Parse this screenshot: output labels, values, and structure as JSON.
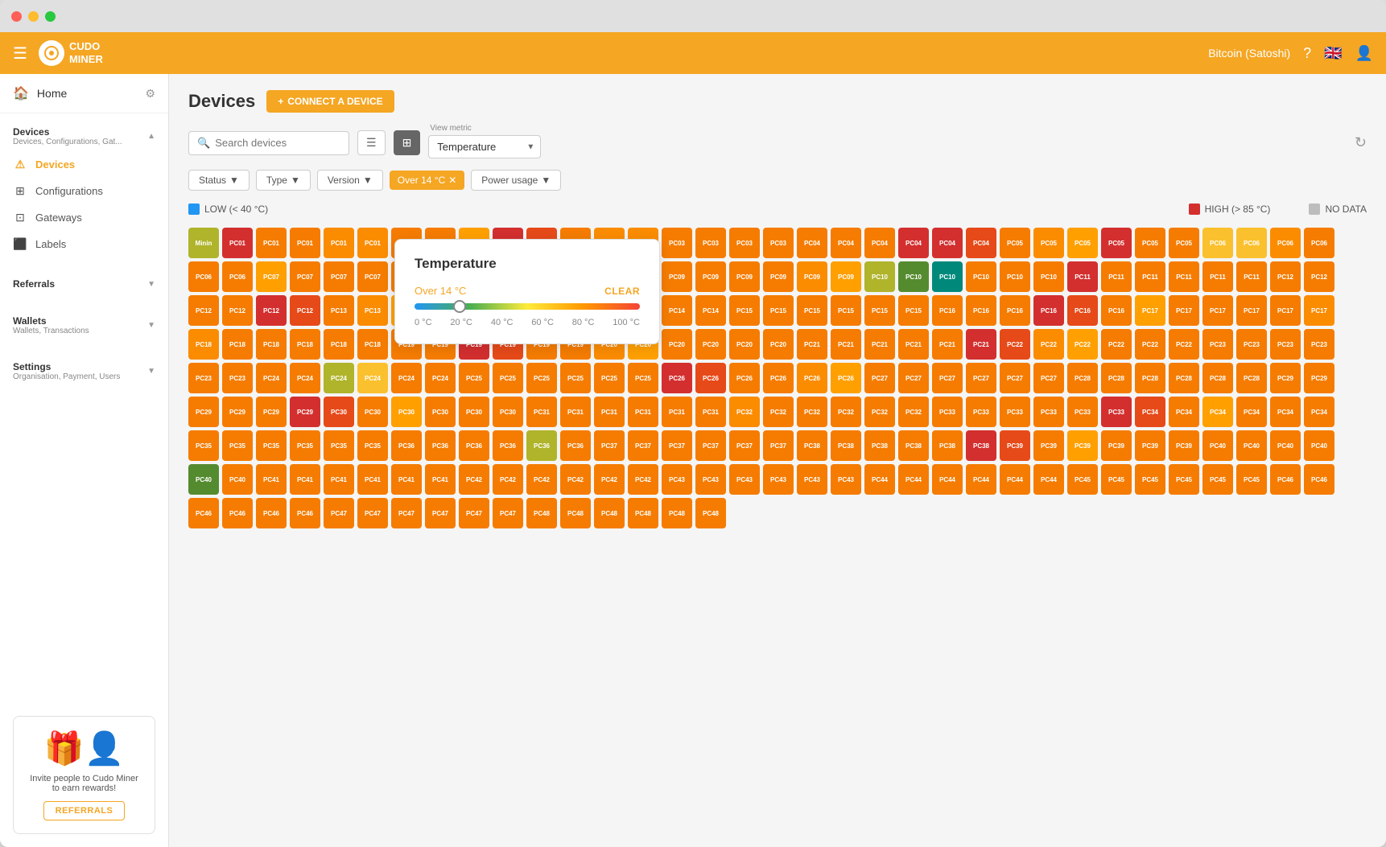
{
  "window": {
    "titlebar": {
      "close": "●",
      "min": "●",
      "max": "●"
    }
  },
  "topnav": {
    "menu_icon": "☰",
    "logo_text": "CUDO\nMINER",
    "currency": "Bitcoin (Satoshi)",
    "help_icon": "?",
    "lang_icon": "🇬🇧",
    "user_icon": "👤"
  },
  "sidebar": {
    "home_label": "Home",
    "gear_icon": "⚙",
    "sections": [
      {
        "title": "Devices",
        "sub": "Devices, Configurations, Gat...",
        "items": [
          {
            "label": "Devices",
            "icon": "⚠",
            "active": true
          },
          {
            "label": "Configurations",
            "icon": "⊞"
          },
          {
            "label": "Gateways",
            "icon": "⊡"
          },
          {
            "label": "Labels",
            "icon": "⬛"
          }
        ]
      },
      {
        "title": "Referrals",
        "sub": "",
        "items": []
      },
      {
        "title": "Wallets",
        "sub": "Wallets, Transactions",
        "items": []
      },
      {
        "title": "Settings",
        "sub": "Organisation, Payment, Users",
        "items": []
      }
    ],
    "referrals": {
      "text": "Invite people to Cudo Miner to earn rewards!",
      "btn_label": "REFERRALS"
    }
  },
  "page": {
    "title": "Devices",
    "connect_btn": "CONNECT A DEVICE",
    "search_placeholder": "Search devices",
    "view_metric_label": "View metric",
    "view_metric_value": "Temperature",
    "filters": {
      "status": "Status",
      "type": "Type",
      "version": "Version",
      "active_filter": "Over 14 °C",
      "power_usage": "Power usage"
    },
    "legend": {
      "low_label": "LOW (< 40 °C)",
      "low_color": "#2196f3",
      "high_label": "HIGH (> 85 °C)",
      "high_color": "#d32f2f",
      "no_data_label": "NO DATA",
      "no_data_color": "#bdbdbd"
    },
    "temp_popup": {
      "title": "Temperature",
      "range_label": "Over 14 °C",
      "clear_label": "CLEAR",
      "scale": [
        "0 °C",
        "20 °C",
        "40 °C",
        "60 °C",
        "80 °C",
        "100 °C"
      ],
      "slider_pos_pct": 20
    },
    "refresh_icon": "↻"
  }
}
